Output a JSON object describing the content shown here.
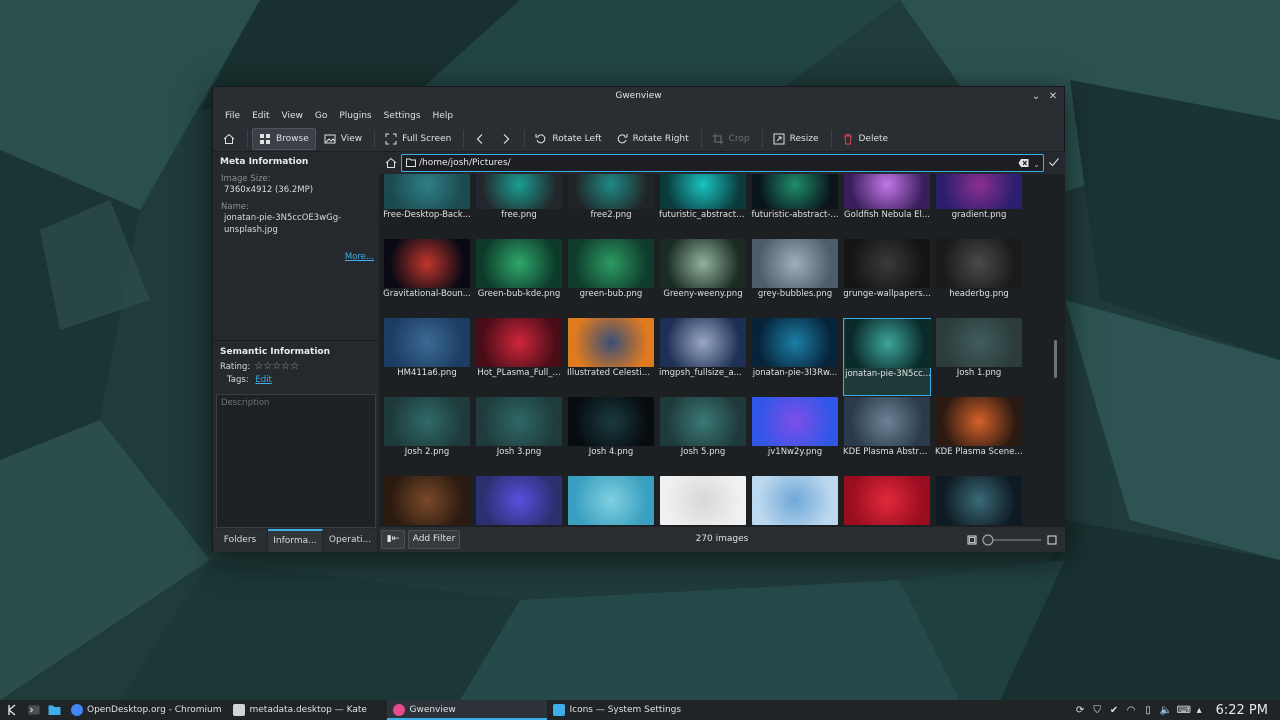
{
  "window": {
    "title": "Gwenview"
  },
  "menu": [
    "File",
    "Edit",
    "View",
    "Go",
    "Plugins",
    "Settings",
    "Help"
  ],
  "toolbar": {
    "browse": "Browse",
    "view": "View",
    "full_screen": "Full Screen",
    "rotate_left": "Rotate Left",
    "rotate_right": "Rotate Right",
    "crop": "Crop",
    "resize": "Resize",
    "delete": "Delete"
  },
  "meta": {
    "heading": "Meta Information",
    "image_size_label": "Image Size:",
    "image_size_value": "7360x4912 (36.2MP)",
    "name_label": "Name:",
    "name_value_1": "jonatan-pie-3N5ccOE3wGg-",
    "name_value_2": "unsplash.jpg",
    "more": "More..."
  },
  "semantic": {
    "heading": "Semantic Information",
    "rating_label": "Rating:",
    "tags_label": "Tags:",
    "tags_edit": "Edit",
    "description_placeholder": "Description"
  },
  "sidetabs": [
    "Folders",
    "Informa...",
    "Operati..."
  ],
  "address": {
    "path": "/home/josh/Pictures/"
  },
  "thumbnails": [
    {
      "name": "Free-Desktop-Back...",
      "colors": [
        "#1b4a50",
        "#2f7f86"
      ]
    },
    {
      "name": "free.png",
      "colors": [
        "#23272b",
        "#1a9e93"
      ]
    },
    {
      "name": "free2.png",
      "colors": [
        "#202427",
        "#1f8a84"
      ]
    },
    {
      "name": "futuristic_abstract_...",
      "colors": [
        "#0b3a3d",
        "#1ac4c0"
      ]
    },
    {
      "name": "futuristic-abstract-...",
      "colors": [
        "#09141b",
        "#1f8d6b"
      ]
    },
    {
      "name": "Goldfish Nebula El...",
      "colors": [
        "#3a1d5c",
        "#c178e6"
      ]
    },
    {
      "name": "gradient.png",
      "colors": [
        "#2b1e6e",
        "#8b2f8f"
      ]
    },
    {
      "name": "Gravitational-Boun...",
      "colors": [
        "#0a0a14",
        "#c0362c"
      ]
    },
    {
      "name": "Green-bub-kde.png",
      "colors": [
        "#0d3b2b",
        "#2fa76a"
      ]
    },
    {
      "name": "green-bub.png",
      "colors": [
        "#0f3c2c",
        "#2c9b62"
      ]
    },
    {
      "name": "Greeny-weeny.png",
      "colors": [
        "#1b2a23",
        "#8fb39b"
      ]
    },
    {
      "name": "grey-bubbles.png",
      "colors": [
        "#4d5d6b",
        "#9fb0bd"
      ]
    },
    {
      "name": "grunge-wallpapers...",
      "colors": [
        "#141414",
        "#3a3a3a"
      ]
    },
    {
      "name": "headerbg.png",
      "colors": [
        "#1a1a1a",
        "#4a4a4a"
      ]
    },
    {
      "name": "HM411a6.png",
      "colors": [
        "#1c3c63",
        "#3b6a94"
      ]
    },
    {
      "name": "Hot_PLasma_Full_...",
      "colors": [
        "#4a0d18",
        "#d0263b"
      ]
    },
    {
      "name": "Illustrated Celestial...",
      "colors": [
        "#e07a1f",
        "#3a4f78"
      ]
    },
    {
      "name": "imgpsh_fullsize_an...",
      "colors": [
        "#1d2f55",
        "#9aa8c3"
      ]
    },
    {
      "name": "jonatan-pie-3l3Rw...",
      "colors": [
        "#07233a",
        "#1b7fa6"
      ]
    },
    {
      "name": "jonatan-pie-3N5cc...",
      "colors": [
        "#0b2a2a",
        "#3da59d"
      ]
    },
    {
      "name": "Josh 1.png",
      "colors": [
        "#2c3b3b",
        "#3f5d5c"
      ]
    },
    {
      "name": "Josh 2.png",
      "colors": [
        "#1e3a3b",
        "#2f6a68"
      ]
    },
    {
      "name": "Josh 3.png",
      "colors": [
        "#1f3b3c",
        "#2e6866"
      ]
    },
    {
      "name": "Josh 4.png",
      "colors": [
        "#070c10",
        "#1a3b40"
      ]
    },
    {
      "name": "Josh 5.png",
      "colors": [
        "#1f3a3a",
        "#3a7a77"
      ]
    },
    {
      "name": "jv1Nw2y.png",
      "colors": [
        "#3157e8",
        "#7f4ee8"
      ]
    },
    {
      "name": "KDE Plasma Abstra...",
      "colors": [
        "#2a3a4a",
        "#6c8395"
      ]
    },
    {
      "name": "KDE Plasma Scener...",
      "colors": [
        "#2b1a12",
        "#d6612a"
      ]
    },
    {
      "name": "",
      "colors": [
        "#2b1a10",
        "#7a4a2a"
      ]
    },
    {
      "name": "",
      "colors": [
        "#2b2f6e",
        "#5a4fe0"
      ]
    },
    {
      "name": "",
      "colors": [
        "#3a9fc0",
        "#7fd0e0"
      ]
    },
    {
      "name": "",
      "colors": [
        "#f0f0f0",
        "#d8d8d8"
      ]
    },
    {
      "name": "",
      "colors": [
        "#bcd8ee",
        "#6fa8d8"
      ]
    },
    {
      "name": "",
      "colors": [
        "#9a0d20",
        "#e02a3a"
      ]
    },
    {
      "name": "",
      "colors": [
        "#0e1a22",
        "#3a6a78"
      ]
    }
  ],
  "selected_index": 19,
  "statusbar": {
    "count": "270 images",
    "add_filter": "Add Filter",
    "zoom_fraction": 0.05
  },
  "taskbar": {
    "tasks": [
      {
        "label": "OpenDesktop.org - Chromium",
        "color": "#4285f4"
      },
      {
        "label": "metadata.desktop — Kate",
        "color": "#cfd4da"
      },
      {
        "label": "Gwenview",
        "color": "#e74c8c"
      },
      {
        "label": "Icons — System Settings",
        "color": "#3daee9"
      }
    ],
    "active_task": 2,
    "clock": "6:22 PM"
  }
}
